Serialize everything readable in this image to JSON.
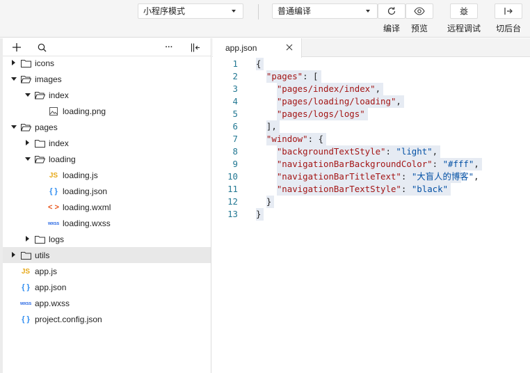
{
  "toolbar": {
    "mode_select": "小程序模式",
    "compile_select": "普通编译",
    "buttons": [
      {
        "label": "编译",
        "icon": "refresh-icon"
      },
      {
        "label": "预览",
        "icon": "eye-icon"
      },
      {
        "label": "远程调试",
        "icon": "bug-icon"
      },
      {
        "label": "切后台",
        "icon": "switch-background-icon"
      }
    ]
  },
  "sidebar": {
    "tools": [
      "add-icon",
      "search-icon",
      "more-icon",
      "collapse-panel-icon"
    ],
    "more_label": "···",
    "tree": [
      {
        "label": "icons",
        "type": "folder",
        "level": 0,
        "expanded": false
      },
      {
        "label": "images",
        "type": "folder",
        "level": 0,
        "expanded": true
      },
      {
        "label": "index",
        "type": "folder",
        "level": 1,
        "expanded": true
      },
      {
        "label": "loading.png",
        "type": "image",
        "level": 2
      },
      {
        "label": "pages",
        "type": "folder",
        "level": 0,
        "expanded": true
      },
      {
        "label": "index",
        "type": "folder",
        "level": 1,
        "expanded": false
      },
      {
        "label": "loading",
        "type": "folder",
        "level": 1,
        "expanded": true
      },
      {
        "label": "loading.js",
        "type": "js",
        "level": 2
      },
      {
        "label": "loading.json",
        "type": "json",
        "level": 2
      },
      {
        "label": "loading.wxml",
        "type": "wxml",
        "level": 2
      },
      {
        "label": "loading.wxss",
        "type": "wxss",
        "level": 2
      },
      {
        "label": "logs",
        "type": "folder",
        "level": 1,
        "expanded": false
      },
      {
        "label": "utils",
        "type": "folder",
        "level": 0,
        "expanded": false,
        "selected": true
      },
      {
        "label": "app.js",
        "type": "js",
        "level": 0
      },
      {
        "label": "app.json",
        "type": "json",
        "level": 0
      },
      {
        "label": "app.wxss",
        "type": "wxss",
        "level": 0
      },
      {
        "label": "project.config.json",
        "type": "json",
        "level": 0
      }
    ],
    "type_glyphs": {
      "js": "JS",
      "json": "{ }",
      "wxml": "< >",
      "wxss": "wxss"
    }
  },
  "editor": {
    "tab": "app.json",
    "lines": [
      {
        "n": "1",
        "tokens": [
          [
            "p",
            "{"
          ]
        ]
      },
      {
        "n": "2",
        "tokens": [
          [
            "p",
            "  "
          ],
          [
            "k",
            "\"pages\""
          ],
          [
            "p",
            ": ["
          ]
        ]
      },
      {
        "n": "3",
        "tokens": [
          [
            "p",
            "    "
          ],
          [
            "k",
            "\"pages/index/index\""
          ],
          [
            "p",
            ","
          ]
        ]
      },
      {
        "n": "4",
        "tokens": [
          [
            "p",
            "    "
          ],
          [
            "k",
            "\"pages/loading/loading\""
          ],
          [
            "p",
            ","
          ]
        ]
      },
      {
        "n": "5",
        "tokens": [
          [
            "p",
            "    "
          ],
          [
            "k",
            "\"pages/logs/logs\""
          ]
        ]
      },
      {
        "n": "6",
        "tokens": [
          [
            "p",
            "  ],"
          ]
        ]
      },
      {
        "n": "7",
        "tokens": [
          [
            "p",
            "  "
          ],
          [
            "k",
            "\"window\""
          ],
          [
            "p",
            ": {"
          ]
        ]
      },
      {
        "n": "8",
        "tokens": [
          [
            "p",
            "    "
          ],
          [
            "k",
            "\"backgroundTextStyle\""
          ],
          [
            "p",
            ": "
          ],
          [
            "s",
            "\"light\""
          ],
          [
            "p",
            ","
          ]
        ]
      },
      {
        "n": "9",
        "tokens": [
          [
            "p",
            "    "
          ],
          [
            "k",
            "\"navigationBarBackgroundColor\""
          ],
          [
            "p",
            ": "
          ],
          [
            "s",
            "\"#fff\""
          ],
          [
            "p",
            ","
          ]
        ]
      },
      {
        "n": "10",
        "tokens": [
          [
            "p",
            "    "
          ],
          [
            "k",
            "\"navigationBarTitleText\""
          ],
          [
            "p",
            ": "
          ],
          [
            "s",
            "\"大盲人的博客\""
          ],
          [
            "p",
            ","
          ]
        ]
      },
      {
        "n": "11",
        "tokens": [
          [
            "p",
            "    "
          ],
          [
            "k",
            "\"navigationBarTextStyle\""
          ],
          [
            "p",
            ": "
          ],
          [
            "s",
            "\"black\""
          ]
        ]
      },
      {
        "n": "12",
        "tokens": [
          [
            "p",
            "  }"
          ]
        ]
      },
      {
        "n": "13",
        "tokens": [
          [
            "p",
            "}"
          ]
        ]
      }
    ]
  }
}
